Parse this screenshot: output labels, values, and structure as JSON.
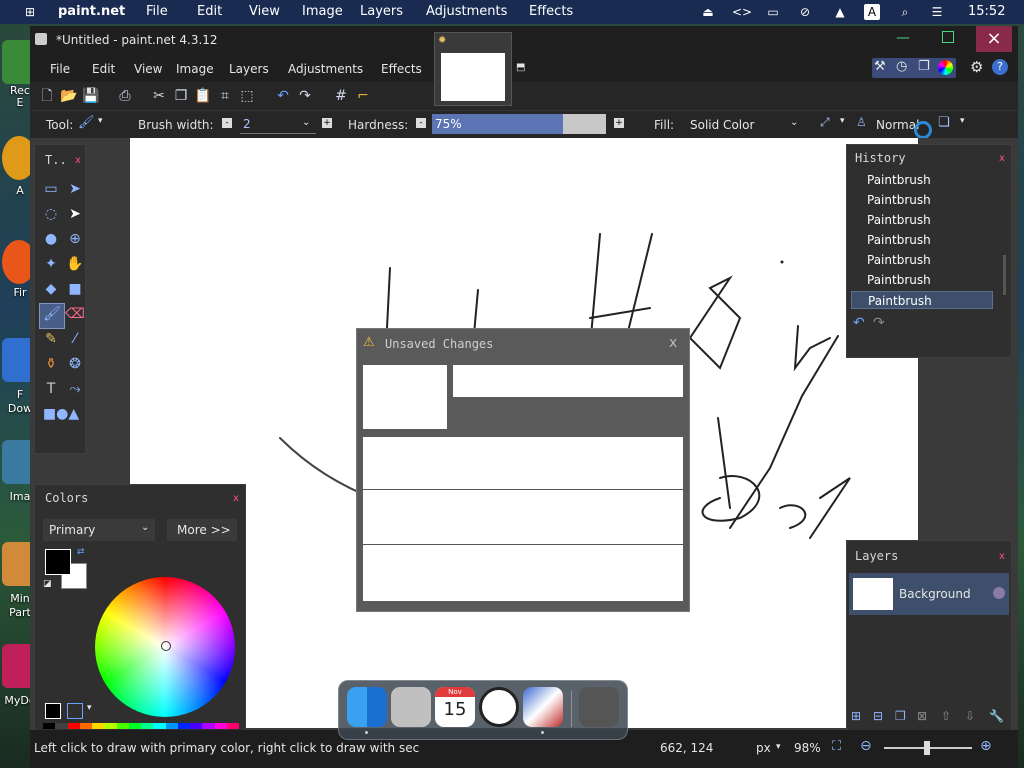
{
  "menubar": {
    "app_name": "paint.net",
    "items": [
      "File",
      "Edit",
      "View",
      "Image",
      "Layers",
      "Adjustments",
      "Effects"
    ],
    "clock": "15:52",
    "tray_letter": "A"
  },
  "desktop": {
    "labels": [
      "Rec",
      "E",
      "A",
      "Fir",
      "F",
      "Dow",
      "Ima",
      "Min",
      "Part",
      "MyDo"
    ]
  },
  "window": {
    "title": "*Untitled - paint.net 4.3.12",
    "menu": [
      "File",
      "Edit",
      "View",
      "Image",
      "Layers",
      "Adjustments",
      "Effects"
    ]
  },
  "toolbar": {
    "tool_label": "Tool:",
    "brush_width_label": "Brush width:",
    "brush_width_value": "2",
    "hardness_label": "Hardness:",
    "hardness_value": "75%",
    "hardness_fraction": 0.75,
    "fill_label": "Fill:",
    "fill_value": "Solid Color",
    "blend_mode": "Normal"
  },
  "tools_panel": {
    "title": "T..",
    "close": "x"
  },
  "history_panel": {
    "title": "History",
    "close": "x",
    "items": [
      "Paintbrush",
      "Paintbrush",
      "Paintbrush",
      "Paintbrush",
      "Paintbrush",
      "Paintbrush",
      "Paintbrush"
    ],
    "selected_index": 6
  },
  "colors_panel": {
    "title": "Colors",
    "close": "x",
    "mode": "Primary",
    "more_label": "More >>",
    "palette": [
      "#000000",
      "#404040",
      "#ff0000",
      "#ff6a00",
      "#ffd800",
      "#b6ff00",
      "#4cff00",
      "#00ff21",
      "#00ff90",
      "#00ffff",
      "#0094ff",
      "#0026ff",
      "#4800ff",
      "#b200ff",
      "#ff00dc",
      "#ff006e"
    ]
  },
  "layers_panel": {
    "title": "Layers",
    "close": "x",
    "layer_name": "Background"
  },
  "dialog": {
    "title": "Unsaved Changes",
    "close": "x"
  },
  "status": {
    "hint": "Left click to draw with primary color, right click to draw with sec",
    "coords": "662, 124",
    "unit": "px",
    "zoom": "98%"
  },
  "dock": {
    "calendar_month": "Nov",
    "calendar_day": "15"
  },
  "colors": {
    "accent": "#5b74b4",
    "menubar": "#1a2b52"
  }
}
